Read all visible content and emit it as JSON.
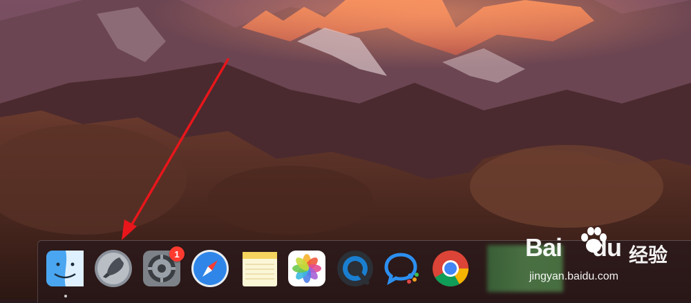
{
  "desktop": {
    "wallpaper": "mountain-landscape-sierra"
  },
  "dock": {
    "items": [
      {
        "name": "Finder",
        "icon": "finder-icon",
        "running": true
      },
      {
        "name": "Launchpad",
        "icon": "rocket-icon",
        "running": false
      },
      {
        "name": "System Preferences",
        "icon": "gear-icon",
        "badge": "1",
        "running": false
      },
      {
        "name": "Safari",
        "icon": "compass-icon",
        "running": false
      },
      {
        "name": "Notes",
        "icon": "notes-icon",
        "running": false
      },
      {
        "name": "Photos",
        "icon": "photos-flower-icon",
        "running": false
      },
      {
        "name": "QuickTime Player",
        "icon": "quicktime-icon",
        "running": false
      },
      {
        "name": "Chat app",
        "icon": "chat-bubbles-icon",
        "running": false
      },
      {
        "name": "Google Chrome",
        "icon": "chrome-icon",
        "running": false
      }
    ]
  },
  "annotation": {
    "arrow_color": "#e8161b"
  },
  "watermark": {
    "logo_bai": "Bai",
    "logo_du": "du",
    "logo_cn": "经验",
    "url": "jingyan.baidu.com"
  }
}
